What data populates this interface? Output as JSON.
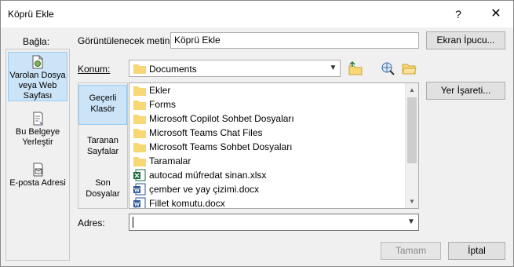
{
  "window": {
    "title": "Köprü Ekle",
    "help_label": "?",
    "close_label": "✕"
  },
  "link_to": {
    "label": "Bağla:",
    "items": [
      {
        "label": "Varolan Dosya veya Web Sayfası",
        "icon": "existing-file-webpage-icon",
        "selected": true
      },
      {
        "label": "Bu Belgeye Yerleştir",
        "icon": "place-in-document-icon",
        "selected": false
      },
      {
        "label": "E-posta Adresi",
        "icon": "email-address-icon",
        "selected": false
      }
    ]
  },
  "display_text": {
    "label": "Görüntülenecek metin:",
    "value": "Köprü Ekle"
  },
  "screentip_button": "Ekran İpucu...",
  "look_in": {
    "label": "Konum:",
    "value": "Documents"
  },
  "bookmark_button": "Yer İşareti...",
  "browse_tabs": [
    {
      "label": "Geçerli Klasör",
      "selected": true
    },
    {
      "label": "Taranan Sayfalar",
      "selected": false
    },
    {
      "label": "Son Dosyalar",
      "selected": false
    }
  ],
  "files": [
    {
      "name": "Ekler",
      "type": "folder"
    },
    {
      "name": "Forms",
      "type": "folder"
    },
    {
      "name": "Microsoft Copilot Sohbet Dosyaları",
      "type": "folder"
    },
    {
      "name": "Microsoft Teams Chat Files",
      "type": "folder"
    },
    {
      "name": "Microsoft Teams Sohbet Dosyaları",
      "type": "folder"
    },
    {
      "name": "Taramalar",
      "type": "folder"
    },
    {
      "name": "autocad müfredat sinan.xlsx",
      "type": "excel"
    },
    {
      "name": "çember ve yay çizimi.docx",
      "type": "word"
    },
    {
      "name": "Fillet komutu.docx",
      "type": "word"
    }
  ],
  "address": {
    "label": "Adres:",
    "value": ""
  },
  "ok_button": "Tamam",
  "cancel_button": "İptal",
  "colors": {
    "selected_bg": "#cce4f7",
    "selected_border": "#99c9ef",
    "folder": "#f8d775",
    "excel": "#1d6f42",
    "word": "#2b579a"
  }
}
